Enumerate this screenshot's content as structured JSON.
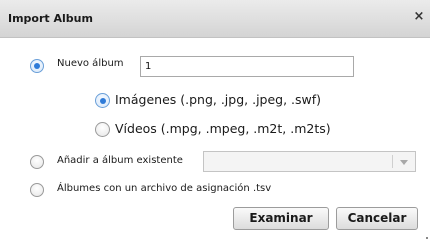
{
  "dialog": {
    "title": "Import Album",
    "close_glyph": "×"
  },
  "options": {
    "new_album_label": "Nuevo álbum",
    "new_album_value": "1",
    "images_label": "Imágenes (.png, .jpg, .jpeg, .swf)",
    "videos_label": "Vídeos (.mpg, .mpeg, .m2t, .m2ts)",
    "existing_album_label": "Añadir a álbum existente",
    "existing_album_value": "",
    "tsv_label": "Álbumes con un archivo de asignación .tsv"
  },
  "selection": {
    "album_mode": "new-album",
    "media_type": "images"
  },
  "buttons": {
    "browse_label": "Examinar",
    "cancel_label": "Cancelar"
  },
  "icons": {
    "close": "close-icon",
    "dropdown": "chevron-down-icon"
  },
  "colors": {
    "radio_selected": "#2f7bd8",
    "titlebar": "#e0e0e0"
  }
}
